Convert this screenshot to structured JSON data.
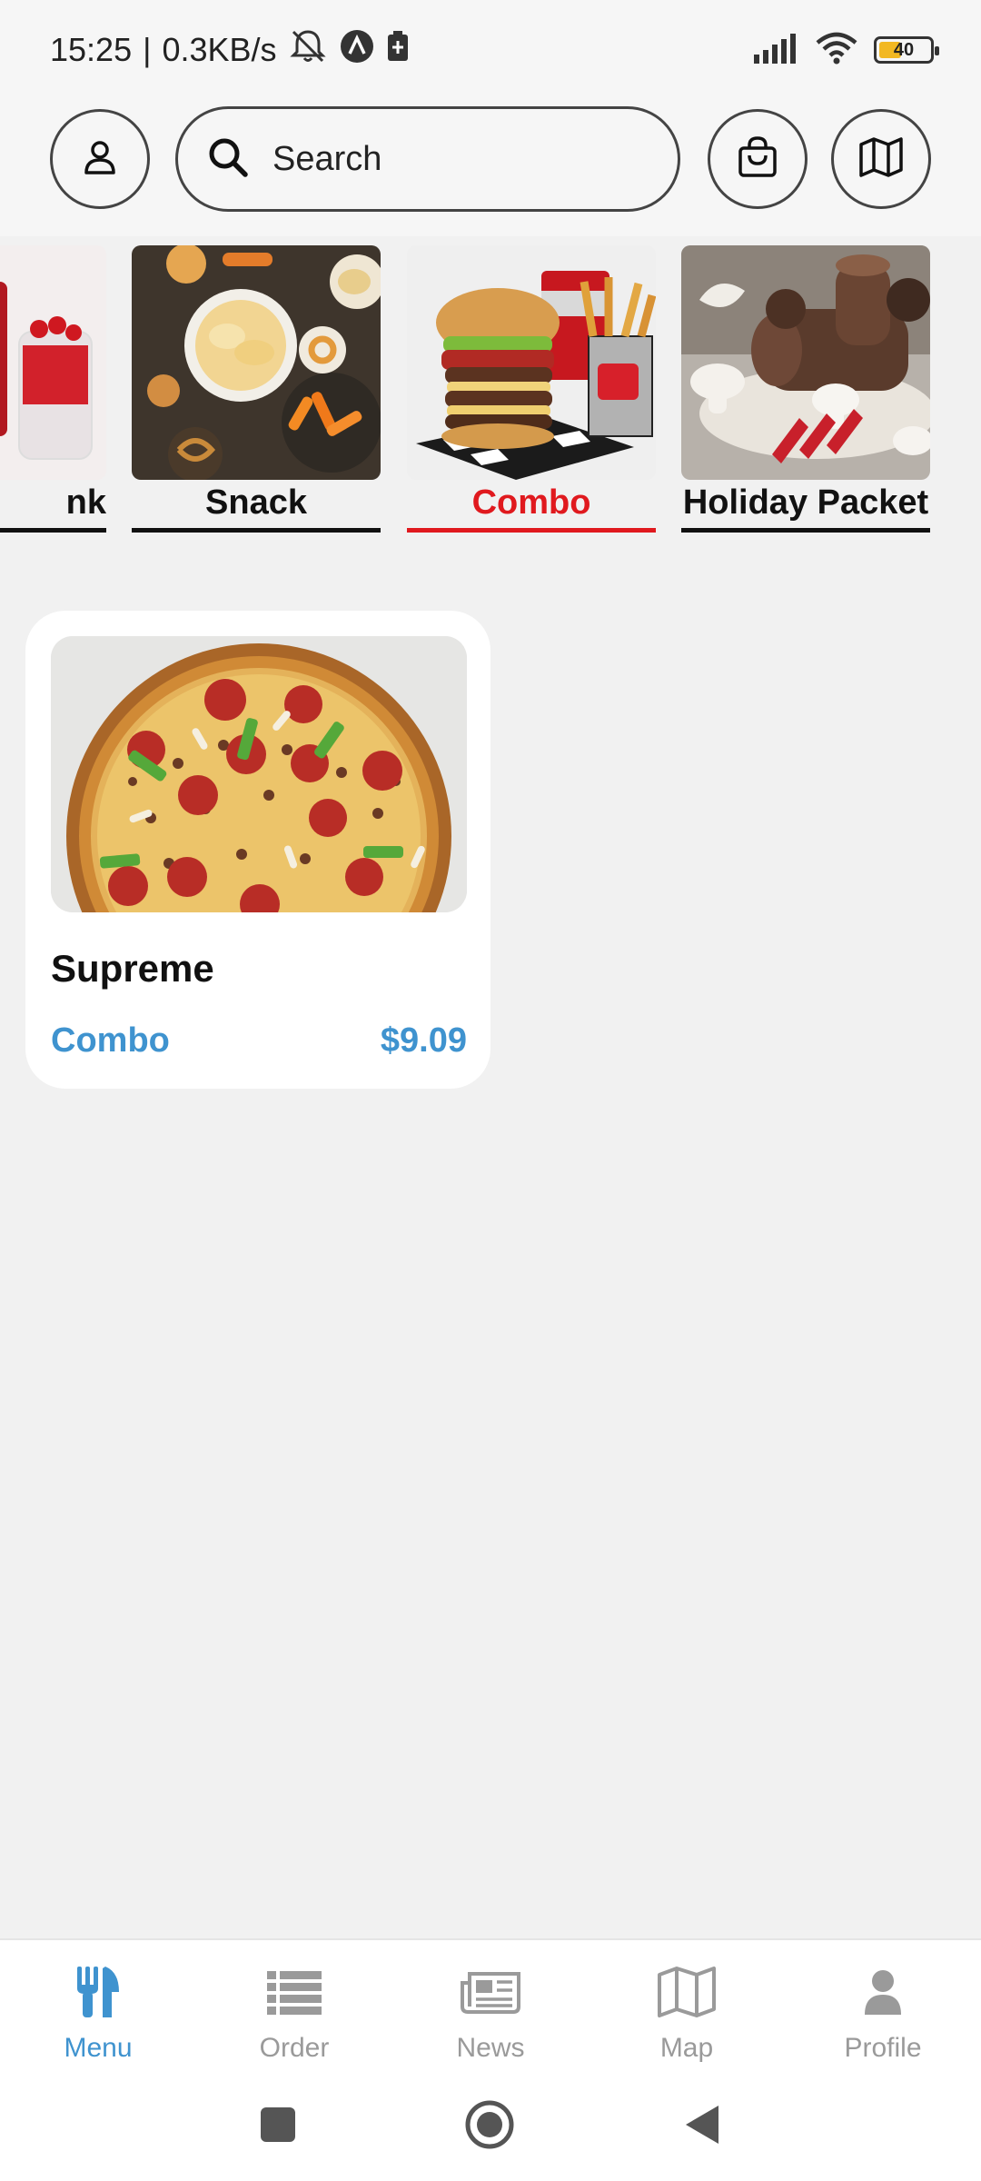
{
  "status_bar": {
    "time": "15:25",
    "separator": "|",
    "speed": "0.3KB/s",
    "battery": "40"
  },
  "header": {
    "search_placeholder": "Search"
  },
  "categories": [
    {
      "label": "Drink",
      "visible_label": "nk",
      "active": false
    },
    {
      "label": "Snack",
      "active": false
    },
    {
      "label": "Combo",
      "active": true
    },
    {
      "label": "Holiday Packet",
      "active": false
    }
  ],
  "product": {
    "name": "Supreme",
    "category": "Combo",
    "price": "$9.09"
  },
  "bottom_nav": [
    {
      "label": "Menu",
      "icon": "utensils-icon",
      "active": true
    },
    {
      "label": "Order",
      "icon": "list-icon",
      "active": false
    },
    {
      "label": "News",
      "icon": "newspaper-icon",
      "active": false
    },
    {
      "label": "Map",
      "icon": "map-icon",
      "active": false
    },
    {
      "label": "Profile",
      "icon": "user-icon",
      "active": false
    }
  ],
  "colors": {
    "accent": "#3f93cf",
    "active_category": "#e0191e",
    "background": "#f1f1f1",
    "inactive_nav": "#9a9a9a"
  }
}
